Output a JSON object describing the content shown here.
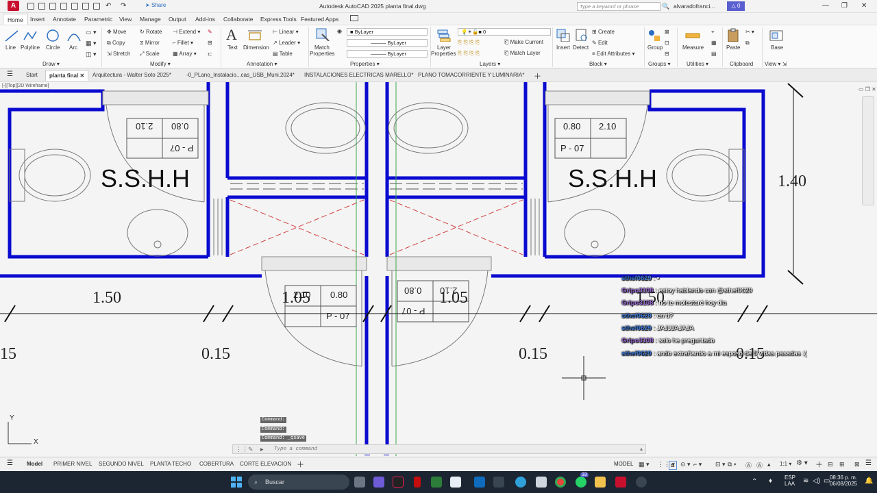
{
  "titlebar": {
    "app_logo": "A",
    "share_label": "Share",
    "window_title": "Autodesk AutoCAD 2025    planta final.dwg",
    "search_placeholder": "Type a keyword or phrase",
    "user_name": "alvaradofranci...",
    "notification_count": "0"
  },
  "ribbon_tabs": [
    "Home",
    "Insert",
    "Annotate",
    "Parametric",
    "View",
    "Manage",
    "Output",
    "Add-ins",
    "Collaborate",
    "Express Tools",
    "Featured Apps"
  ],
  "ribbon": {
    "draw": {
      "line": "Line",
      "polyline": "Polyline",
      "circle": "Circle",
      "arc": "Arc",
      "group_label": "Draw"
    },
    "modify": {
      "move": "Move",
      "rotate": "Rotate",
      "extend": "Extend",
      "copy": "Copy",
      "mirror": "Mirror",
      "fillet": "Fillet",
      "stretch": "Stretch",
      "scale": "Scale",
      "array": "Array",
      "group_label": "Modify"
    },
    "annotation": {
      "text": "Text",
      "dimension": "Dimension",
      "linear": "Linear",
      "leader": "Leader",
      "table": "Table",
      "group_label": "Annotation"
    },
    "properties": {
      "match": "Match",
      "properties": "Properties",
      "bylayer1": "ByLayer",
      "bylayer2": "ByLayer",
      "bylayer3": "ByLayer",
      "group_label": "Properties"
    },
    "layers": {
      "layer": "Layer",
      "properties": "Properties",
      "current_layer": "0",
      "make_current": "Make Current",
      "match_layer": "Match Layer",
      "group_label": "Layers"
    },
    "block": {
      "insert": "Insert",
      "detect": "Detect",
      "create": "Create",
      "edit": "Edit",
      "edit_attributes": "Edit Attributes",
      "group_label": "Block"
    },
    "groups": {
      "group": "Group",
      "group_label": "Groups"
    },
    "utilities": {
      "measure": "Measure",
      "group_label": "Utilities"
    },
    "clipboard": {
      "paste": "Paste",
      "group_label": "Clipboard"
    },
    "view": {
      "base": "Base",
      "group_label": "View"
    }
  },
  "file_tabs": {
    "start": "Start",
    "tabs": [
      "planta final",
      "Arquitectura - Walter Soto 2025*",
      "-0_PLano_Instalacio...cas_USB_Muni.2024*",
      "INSTALACIONES ELECTRICAS MARELLO*",
      "PLANO TOMACORRIENTE Y LUMINARIA*"
    ]
  },
  "canvas": {
    "view_label": "[-][Top][2D Wireframe]",
    "room_label_left": "S.S.H.H",
    "room_label_right": "S.S.H.H",
    "door_tag": {
      "width": "0.80",
      "height": "2.10",
      "code": "P - 07"
    },
    "dims": {
      "d150": "1.50",
      "d015": "0.15",
      "d105": "1.05",
      "d140": "1.40",
      "d15": "15",
      "d150b": "1.50"
    },
    "ucs_x": "X",
    "ucs_y": "Y"
  },
  "chat": [
    {
      "user": "sthef0629",
      "msg": "",
      "color": "#3c78d8",
      "suffix_icon": true
    },
    {
      "user": "Gripo3108",
      "msg": "estoy hablando con @sthef0629",
      "color": "#9c6ad8"
    },
    {
      "user": "Gripo3108",
      "msg": "no te molestaré hoy dia",
      "color": "#9c6ad8"
    },
    {
      "user": "sthef0629",
      "msg": "en ti?",
      "color": "#3c78d8"
    },
    {
      "user": "sthef0629",
      "msg": "JAJJJAJAJA",
      "color": "#3c78d8"
    },
    {
      "user": "Gripo3108",
      "msg": "solo he preguntado",
      "color": "#9c6ad8"
    },
    {
      "user": "sthef0629",
      "msg": "ando extrañando a mi esposo de 5 vidas pasadas :(",
      "color": "#3c78d8"
    }
  ],
  "command": {
    "history": [
      "Command:",
      "Command:",
      "Command:  _qsave"
    ],
    "placeholder": "Type a command"
  },
  "layout_tabs": [
    "Model",
    "PRIMER NIVEL",
    "SEGUNDO NIVEL",
    "PLANTA TECHO",
    "COBERTURA",
    "CORTE ELEVACION"
  ],
  "status": {
    "model": "MODEL",
    "scale": "1:1"
  },
  "taskbar": {
    "search": "Buscar",
    "lang1": "ESP",
    "lang2": "LAA",
    "time": "08:36 p. m.",
    "date": "06/08/2025",
    "badge": "33"
  },
  "colors": {
    "wall": "#0a0ad0",
    "accent": "#5a5fd0",
    "user_a": "#3c78d8",
    "user_b": "#9c6ad8"
  }
}
